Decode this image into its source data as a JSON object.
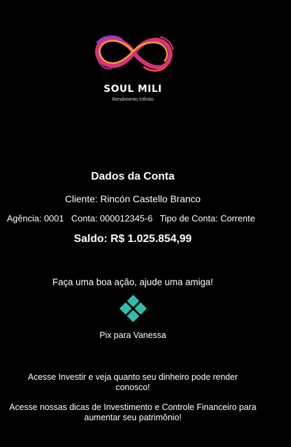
{
  "brand": {
    "logo_icon": "infinity-logo-icon",
    "name": "SOUL MILI",
    "tagline": "Rendimento Infinito",
    "colors": [
      "#d8327a",
      "#f2a42a",
      "#8a3ad1",
      "#e64a3c"
    ]
  },
  "account": {
    "title": "Dados da Conta",
    "client": "Cliente: Rincón Castello Branco",
    "agency": "Agência: 0001",
    "number": "Conta: 000012345-6",
    "type": "Tipo de Conta: Corrente",
    "balance": "Saldo: R$ 1.025.854,99"
  },
  "help": {
    "text": "Faça uma boa ação, ajude uma amiga!",
    "pix_icon": "pix-icon",
    "pix_color": "#32bcad",
    "pix_label": "Pix para Vanessa"
  },
  "footer": {
    "invest": "Acesse Investir e veja quanto seu dinheiro pode render conosco!",
    "tips": "Acesse nossas dicas de Investimento e Controle Financeiro para aumentar seu patrimônio!"
  }
}
